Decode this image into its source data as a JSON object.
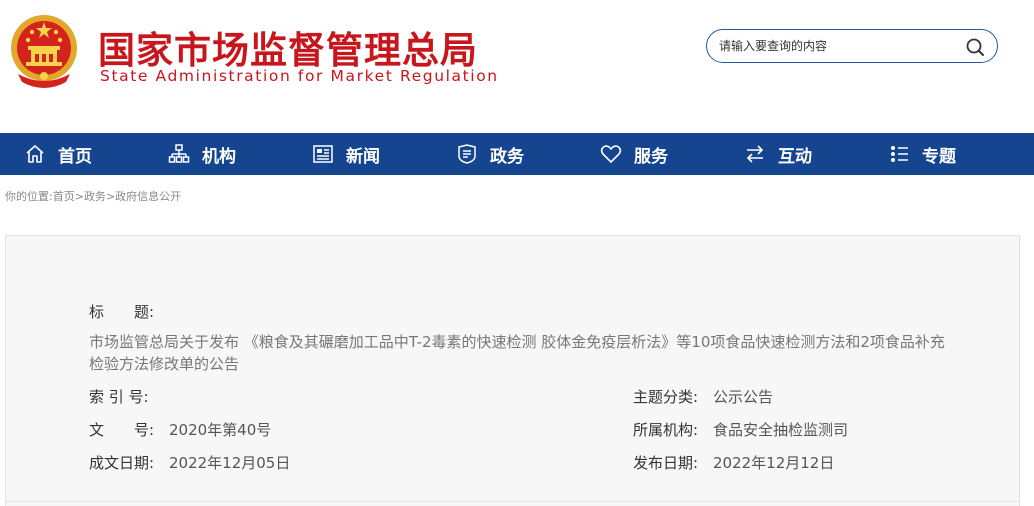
{
  "header": {
    "title_cn": "国家市场监督管理总局",
    "title_en": "State Administration for Market Regulation",
    "brand_color": "#c8161d"
  },
  "search": {
    "placeholder": "请输入要查询的内容",
    "icon": "search-icon"
  },
  "nav": {
    "background": "#14458e",
    "items": [
      {
        "label": "首页",
        "icon": "home-icon"
      },
      {
        "label": "机构",
        "icon": "org-chart-icon"
      },
      {
        "label": "新闻",
        "icon": "newspaper-icon"
      },
      {
        "label": "政务",
        "icon": "shield-document-icon"
      },
      {
        "label": "服务",
        "icon": "heart-icon"
      },
      {
        "label": "互动",
        "icon": "exchange-arrows-icon"
      },
      {
        "label": "专题",
        "icon": "topic-list-icon"
      }
    ]
  },
  "breadcrumb": {
    "prefix": "你的位置:",
    "items": [
      "首页",
      "政务",
      "政府信息公开"
    ],
    "separator": ">"
  },
  "info": {
    "title_label": "标　　题:",
    "title_value": "市场监管总局关于发布 《粮食及其碾磨加工品中T-2毒素的快速检测 胶体金免疫层析法》等10项食品快速检测方法和2项食品补充检验方法修改单的公告",
    "index_label": "索 引 号:",
    "index_value": "",
    "category_label": "主题分类:",
    "category_value": "公示公告",
    "doc_no_label": "文　　号:",
    "doc_no_value": "2020年第40号",
    "org_label": "所属机构:",
    "org_value": "食品安全抽检监测司",
    "created_label": "成文日期:",
    "created_value": "2022年12月05日",
    "published_label": "发布日期:",
    "published_value": "2022年12月12日"
  }
}
